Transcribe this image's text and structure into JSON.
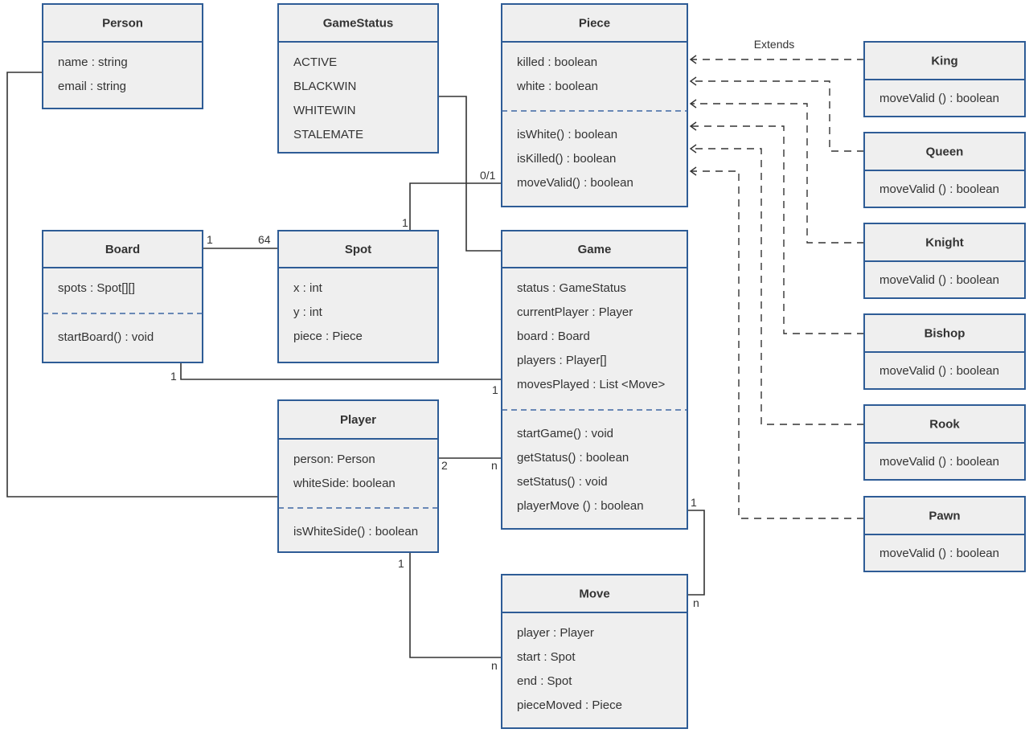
{
  "diagram": {
    "type": "UML class diagram",
    "colors": {
      "box_fill": "#efefef",
      "box_border": "#2e5c96",
      "line": "#333333"
    },
    "classes": [
      {
        "id": "person",
        "name": "Person",
        "attributes": [
          "name : string",
          "email : string"
        ],
        "methods": []
      },
      {
        "id": "gamestatus",
        "name": "GameStatus",
        "attributes": [
          "ACTIVE",
          "BLACKWIN",
          "WHITEWIN",
          "STALEMATE"
        ],
        "methods": []
      },
      {
        "id": "piece",
        "name": "Piece",
        "attributes": [
          "killed : boolean",
          "white : boolean"
        ],
        "methods": [
          "isWhite() : boolean",
          "isKilled() : boolean",
          "moveValid() : boolean"
        ]
      },
      {
        "id": "king",
        "name": "King",
        "attributes": [],
        "methods": [
          "moveValid () : boolean"
        ]
      },
      {
        "id": "queen",
        "name": "Queen",
        "attributes": [],
        "methods": [
          "moveValid () : boolean"
        ]
      },
      {
        "id": "knight",
        "name": "Knight",
        "attributes": [],
        "methods": [
          "moveValid () : boolean"
        ]
      },
      {
        "id": "bishop",
        "name": "Bishop",
        "attributes": [],
        "methods": [
          "moveValid () : boolean"
        ]
      },
      {
        "id": "rook",
        "name": "Rook",
        "attributes": [],
        "methods": [
          "moveValid () : boolean"
        ]
      },
      {
        "id": "pawn",
        "name": "Pawn",
        "attributes": [],
        "methods": [
          "moveValid () : boolean"
        ]
      },
      {
        "id": "board",
        "name": "Board",
        "attributes": [
          "spots : Spot[][]"
        ],
        "methods": [
          "startBoard() : void"
        ]
      },
      {
        "id": "spot",
        "name": "Spot",
        "attributes": [
          "x : int",
          "y : int",
          "piece : Piece"
        ],
        "methods": []
      },
      {
        "id": "game",
        "name": "Game",
        "attributes": [
          "status : GameStatus",
          "currentPlayer : Player",
          "board : Board",
          "players : Player[]",
          "movesPlayed : List <Move>"
        ],
        "methods": [
          "startGame() : void",
          "getStatus() : boolean",
          "setStatus() : void",
          "playerMove () : boolean"
        ]
      },
      {
        "id": "player",
        "name": "Player",
        "attributes": [
          "person: Person",
          "whiteSide: boolean"
        ],
        "methods": [
          "isWhiteSide() : boolean"
        ]
      },
      {
        "id": "move",
        "name": "Move",
        "attributes": [
          "player : Player",
          "start : Spot",
          "end : Spot",
          "pieceMoved : Piece"
        ],
        "methods": []
      }
    ],
    "associations": [
      {
        "id": "person-player",
        "from": "Person",
        "to": "Player",
        "labels": []
      },
      {
        "id": "gamestatus-game",
        "from": "GameStatus",
        "to": "Game",
        "labels": []
      },
      {
        "id": "spot-piece",
        "from": "Spot",
        "to": "Piece",
        "labels": [
          "1",
          "0/1"
        ]
      },
      {
        "id": "board-spot",
        "from": "Board",
        "to": "Spot",
        "labels": [
          "1",
          "64"
        ]
      },
      {
        "id": "board-game",
        "from": "Board",
        "to": "Game",
        "labels": [
          "1",
          "1"
        ]
      },
      {
        "id": "player-game",
        "from": "Player",
        "to": "Game",
        "labels": [
          "2",
          "n"
        ]
      },
      {
        "id": "game-move",
        "from": "Game",
        "to": "Move",
        "labels": [
          "1",
          "n"
        ]
      },
      {
        "id": "player-move",
        "from": "Player",
        "to": "Move",
        "labels": [
          "1",
          "n"
        ]
      }
    ],
    "inheritance": {
      "label": "Extends",
      "parent": "Piece",
      "children": [
        "King",
        "Queen",
        "Knight",
        "Bishop",
        "Rook",
        "Pawn"
      ]
    }
  }
}
